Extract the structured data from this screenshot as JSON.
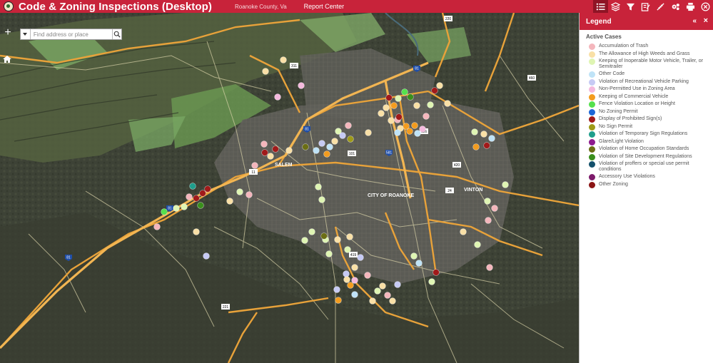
{
  "header": {
    "title": "Code & Zoning Inspections (Desktop)",
    "subtitle": "Roanoke County, Va",
    "report_link": "Report Center",
    "tools": [
      {
        "icon": "legend-list-icon",
        "active": true
      },
      {
        "icon": "layers-icon",
        "active": false
      },
      {
        "icon": "filter-icon",
        "active": false
      },
      {
        "icon": "edit-icon",
        "active": false
      },
      {
        "icon": "measure-ruler-icon",
        "active": false
      },
      {
        "icon": "gear-icon",
        "active": false
      },
      {
        "icon": "print-icon",
        "active": false
      },
      {
        "icon": "close-circle-icon",
        "active": false
      }
    ]
  },
  "search": {
    "placeholder": "Find address or place"
  },
  "map": {
    "zoom_in_label": "+",
    "place_labels": [
      "SALEM",
      "CITY OF ROANOKE",
      "VINTON"
    ],
    "route_shields": [
      "220",
      "311",
      "81",
      "460",
      "116",
      "581",
      "11",
      "419",
      "24",
      "221",
      "420",
      "101"
    ]
  },
  "legend": {
    "title": "Legend",
    "collapse_glyph": "«",
    "close_glyph": "×",
    "layer_name": "Active Cases",
    "items": [
      {
        "label": "Accumulation of Trash",
        "color": "#f4b6bc"
      },
      {
        "label": "The Allowance of High Weeds and Grass",
        "color": "#f9e0a6"
      },
      {
        "label": "Keeping of Inoperable Motor Vehicle, Trailer, or Semitrailer",
        "color": "#dff5b3"
      },
      {
        "label": "Other Code",
        "color": "#bfe3f7"
      },
      {
        "label": "Violation of Recreational Vehicle Parking",
        "color": "#c6caf4"
      },
      {
        "label": "Non-Permitted Use in Zoning Area",
        "color": "#f4b9dd"
      },
      {
        "label": "Keeping of Commercial Vehicle",
        "color": "#f39c1f"
      },
      {
        "label": "Fence Violation Location or Height",
        "color": "#55e04d"
      },
      {
        "label": "No Zoning Permit",
        "color": "#1d66d6"
      },
      {
        "label": "Display of Prohibited Sign(s)",
        "color": "#a11a1a"
      },
      {
        "label": "No Sign Permit",
        "color": "#9e9a18"
      },
      {
        "label": "Violation of Temporary Sign Regulations",
        "color": "#1f9e8c"
      },
      {
        "label": "Glare/Light Violation",
        "color": "#8e1c8e"
      },
      {
        "label": "Violation of Home Occupation Standards",
        "color": "#6b6e14"
      },
      {
        "label": "Violation of Site Development Regulations",
        "color": "#3a8f1c"
      },
      {
        "label": "Violation of proffers or special use permit conditions",
        "color": "#13506b"
      },
      {
        "label": "Accessory Use Violations",
        "color": "#7d1b6b"
      },
      {
        "label": "Other Zoning",
        "color": "#8b1414"
      }
    ]
  }
}
